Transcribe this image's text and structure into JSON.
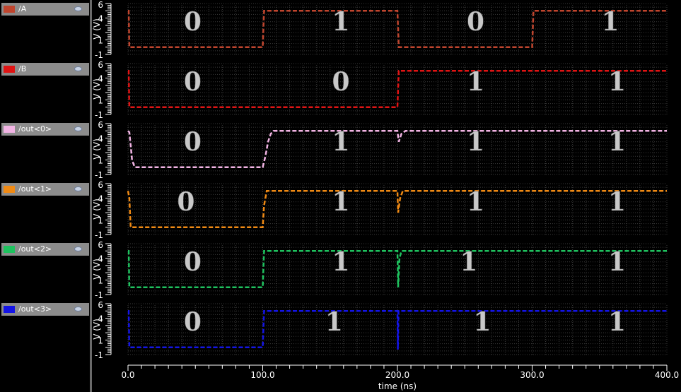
{
  "signals": [
    {
      "name": "/A",
      "color": "#c0452e",
      "points": [
        [
          0,
          5
        ],
        [
          0.5,
          5
        ],
        [
          1,
          0
        ],
        [
          100,
          0
        ],
        [
          101,
          5
        ],
        [
          200,
          5
        ],
        [
          201,
          0
        ],
        [
          300,
          0
        ],
        [
          301,
          5
        ],
        [
          400,
          5
        ]
      ],
      "bits": [
        {
          "label": "0",
          "at_ns": 48
        },
        {
          "label": "1",
          "at_ns": 158
        },
        {
          "label": "0",
          "at_ns": 258
        },
        {
          "label": "1",
          "at_ns": 358
        }
      ]
    },
    {
      "name": "/B",
      "color": "#e01414",
      "points": [
        [
          0,
          5
        ],
        [
          0.5,
          5
        ],
        [
          1,
          0
        ],
        [
          200,
          0
        ],
        [
          201,
          5
        ],
        [
          400,
          5
        ]
      ],
      "bits": [
        {
          "label": "0",
          "at_ns": 48
        },
        {
          "label": "0",
          "at_ns": 158
        },
        {
          "label": "1",
          "at_ns": 258
        },
        {
          "label": "1",
          "at_ns": 363
        }
      ]
    },
    {
      "name": "/out<0>",
      "color": "#f2b4e4",
      "points": [
        [
          0,
          5
        ],
        [
          1,
          4.8
        ],
        [
          2,
          3
        ],
        [
          3,
          1
        ],
        [
          5,
          0
        ],
        [
          100,
          0
        ],
        [
          102,
          1.5
        ],
        [
          104,
          3.5
        ],
        [
          106,
          4.6
        ],
        [
          108,
          5
        ],
        [
          200,
          5
        ],
        [
          201,
          3.5
        ],
        [
          203,
          4.6
        ],
        [
          206,
          5
        ],
        [
          400,
          5
        ]
      ],
      "bits": [
        {
          "label": "0",
          "at_ns": 48
        },
        {
          "label": "1",
          "at_ns": 158
        },
        {
          "label": "1",
          "at_ns": 258
        },
        {
          "label": "1",
          "at_ns": 363
        }
      ]
    },
    {
      "name": "/out<1>",
      "color": "#f08a14",
      "points": [
        [
          0,
          5
        ],
        [
          1,
          4
        ],
        [
          2,
          0
        ],
        [
          100,
          0
        ],
        [
          101,
          3
        ],
        [
          103,
          5
        ],
        [
          200,
          5
        ],
        [
          200.5,
          2
        ],
        [
          202,
          4
        ],
        [
          204,
          5
        ],
        [
          400,
          5
        ]
      ],
      "bits": [
        {
          "label": "0",
          "at_ns": 43
        },
        {
          "label": "1",
          "at_ns": 158
        },
        {
          "label": "1",
          "at_ns": 258
        },
        {
          "label": "1",
          "at_ns": 363
        }
      ]
    },
    {
      "name": "/out<2>",
      "color": "#1ec25e",
      "points": [
        [
          0,
          5
        ],
        [
          0.5,
          5
        ],
        [
          1,
          0
        ],
        [
          100,
          0
        ],
        [
          101,
          5
        ],
        [
          200,
          5
        ],
        [
          200.5,
          0
        ],
        [
          201.5,
          4
        ],
        [
          203,
          5
        ],
        [
          400,
          5
        ]
      ],
      "bits": [
        {
          "label": "0",
          "at_ns": 48
        },
        {
          "label": "1",
          "at_ns": 158
        },
        {
          "label": "1",
          "at_ns": 253
        },
        {
          "label": "1",
          "at_ns": 363
        }
      ]
    },
    {
      "name": "/out<3>",
      "color": "#1414e6",
      "points": [
        [
          0,
          5
        ],
        [
          0.5,
          5
        ],
        [
          1,
          0
        ],
        [
          100,
          0
        ],
        [
          101,
          5
        ],
        [
          200,
          5
        ],
        [
          200.3,
          -0.3
        ],
        [
          200.8,
          5
        ],
        [
          400,
          5
        ]
      ],
      "bits": [
        {
          "label": "0",
          "at_ns": 48
        },
        {
          "label": "1",
          "at_ns": 153
        },
        {
          "label": "1",
          "at_ns": 263
        },
        {
          "label": "1",
          "at_ns": 363
        }
      ]
    }
  ],
  "y_axis": {
    "label": "V (V)",
    "ticks": [
      "6",
      "4",
      "1",
      "-1"
    ],
    "range": [
      -1,
      6
    ]
  },
  "x_axis": {
    "label": "time (ns)",
    "ticks": [
      "0.0",
      "100.0",
      "200.0",
      "300.0",
      "400.0"
    ],
    "range": [
      0,
      400
    ]
  }
}
